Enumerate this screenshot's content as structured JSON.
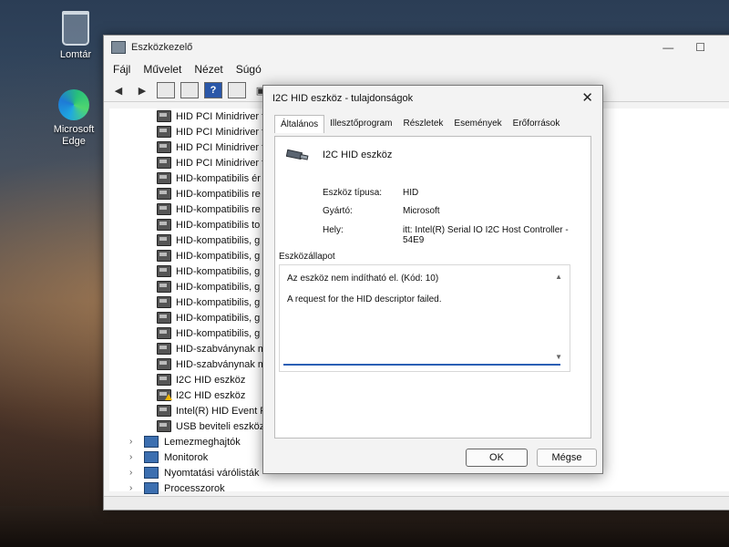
{
  "desktop": {
    "icons": [
      {
        "label": "Lomtár",
        "icon": "recycle-bin-icon"
      },
      {
        "label": "Microsoft Edge",
        "icon": "edge-icon"
      }
    ]
  },
  "main_window": {
    "title": "Eszközkezelő",
    "menu": [
      "Fájl",
      "Művelet",
      "Nézet",
      "Súgó"
    ],
    "tree_items": [
      {
        "label": "HID PCI Minidriver f",
        "warning": false
      },
      {
        "label": "HID PCI Minidriver f",
        "warning": false
      },
      {
        "label": "HID PCI Minidriver f",
        "warning": false
      },
      {
        "label": "HID PCI Minidriver f",
        "warning": false
      },
      {
        "label": "HID-kompatibilis ér",
        "warning": false
      },
      {
        "label": "HID-kompatibilis re",
        "warning": false
      },
      {
        "label": "HID-kompatibilis re",
        "warning": false
      },
      {
        "label": "HID-kompatibilis to",
        "warning": false
      },
      {
        "label": "HID-kompatibilis, g",
        "warning": false
      },
      {
        "label": "HID-kompatibilis, g",
        "warning": false
      },
      {
        "label": "HID-kompatibilis, g",
        "warning": false
      },
      {
        "label": "HID-kompatibilis, g",
        "warning": false
      },
      {
        "label": "HID-kompatibilis, g",
        "warning": false
      },
      {
        "label": "HID-kompatibilis, g",
        "warning": false
      },
      {
        "label": "HID-kompatibilis, g",
        "warning": false
      },
      {
        "label": "HID-szabványnak m",
        "warning": false
      },
      {
        "label": "HID-szabványnak m",
        "warning": false
      },
      {
        "label": "I2C HID eszköz",
        "warning": false
      },
      {
        "label": "I2C HID eszköz",
        "warning": true
      },
      {
        "label": "Intel(R) HID Event F",
        "warning": false
      },
      {
        "label": "USB beviteli eszköz",
        "warning": false
      }
    ],
    "categories": [
      "Lemezmeghajtók",
      "Monitorok",
      "Nyomtatási várólisták",
      "Processzorok"
    ]
  },
  "dialog": {
    "title": "I2C HID eszköz - tulajdonságok",
    "close": "✕",
    "tabs": [
      "Általános",
      "Illesztőprogram",
      "Részletek",
      "Események",
      "Erőforrások"
    ],
    "device_name": "I2C HID eszköz",
    "properties": [
      {
        "label": "Eszköz típusa:",
        "value": "HID"
      },
      {
        "label": "Gyártó:",
        "value": "Microsoft"
      },
      {
        "label": "Hely:",
        "value": "itt: Intel(R) Serial IO I2C Host Controller - 54E9"
      }
    ],
    "status_title": "Eszközállapot",
    "status_line1": "Az eszköz nem indítható el. (Kód: 10)",
    "status_line2": "A request for the HID descriptor failed.",
    "ok": "OK",
    "cancel": "Mégse"
  }
}
